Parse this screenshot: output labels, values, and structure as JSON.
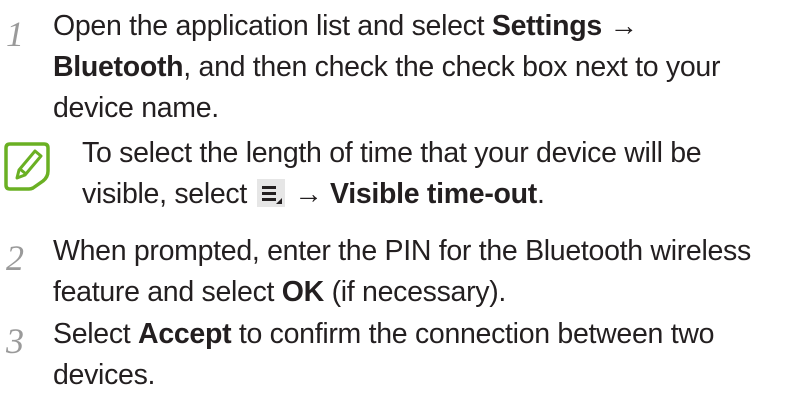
{
  "steps": [
    {
      "number": "1",
      "text_a": "Open the application list and select ",
      "bold_a": "Settings",
      "arrow_a": " →",
      "bold_b": "Bluetooth",
      "text_b": ", and then check the check box next to your device name."
    },
    {
      "number": "2",
      "text_a": "When prompted, enter the PIN for the Bluetooth wireless feature and select ",
      "bold_a": "OK",
      "text_b": " (if necessary)."
    },
    {
      "number": "3",
      "text_a": "Select ",
      "bold_a": "Accept",
      "text_b": " to confirm the connection between two devices."
    }
  ],
  "note": {
    "text_a": "To select the length of time that your device will be visible, select ",
    "icon": "menu-key-icon",
    "arrow": " → ",
    "bold": "Visible time-out",
    "text_b": "."
  },
  "colors": {
    "step_number": "#9a9a9a",
    "note_icon": "#6ab023",
    "text": "#231f20"
  }
}
